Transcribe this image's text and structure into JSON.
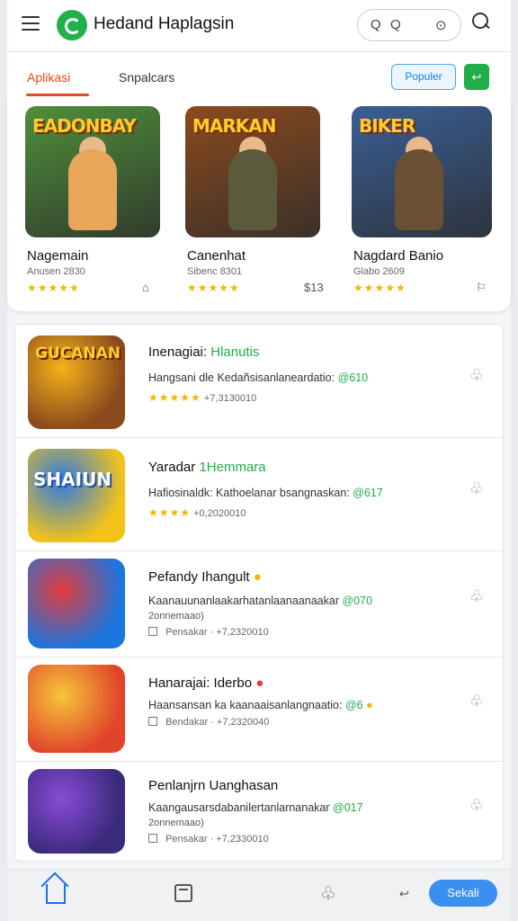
{
  "header": {
    "title": "Hedand Haplagsin",
    "pill_icons": [
      "Q",
      "Q",
      "⊙"
    ]
  },
  "tabs": {
    "items": [
      "Aplikasi",
      "Snpalcars"
    ],
    "popular_label": "Populer",
    "green_button": "↩"
  },
  "featured": [
    {
      "banner": "EADONBAY",
      "name": "Nagemain",
      "meta": "Anusen 2830",
      "rating": "★★★★★",
      "right": "⌂",
      "bg": "#4f8f3a",
      "hero": "#e8a65a"
    },
    {
      "banner": "MARKAN",
      "name": "Canenhat",
      "meta": "Sibenc 8301",
      "rating": "★★★★★",
      "right": "$13",
      "bg": "#8b4a1e",
      "hero": "#5c5a3c"
    },
    {
      "banner": "BIKER",
      "name": "Nagdard Banio",
      "meta": "Glabo 2609",
      "rating": "★★★★★",
      "right": "⚐",
      "bg": "#3a5f95",
      "hero": "#6b5036"
    }
  ],
  "list": [
    {
      "title": "Inenagiai:",
      "tag": "Hlanutis",
      "desc": "Hangsani dle Kedañsisanlaneardatio:",
      "price": "@610",
      "sub": "",
      "meta_stars": "★★★★★",
      "meta": "+7,3130010",
      "bg": "#8a4a1c",
      "accent": "#f5b21b",
      "label": "GUCANAN"
    },
    {
      "title": "Yaradar",
      "tag": "1Hemmara",
      "desc": "Hafiosinaldk: Kathoelanar bsangnaskan:",
      "price": "@617",
      "sub": "",
      "meta_stars": "★★★★",
      "meta": "+0,2020010",
      "bg": "#f2c21a",
      "accent": "#2c7be5",
      "label": "SHAIUN"
    },
    {
      "title": "Pefandy Ihangult",
      "tag": "",
      "desc": "Kaanauunanlaakarhatanlaanaanaakar",
      "price": "@070",
      "sub": "2onnemaao)",
      "meta_stars": "",
      "meta": "Pensakar · +7,2320010",
      "bg": "#1b76e0",
      "accent": "#e23b3b",
      "label": ""
    },
    {
      "title": "Hanarajai: Iderbo",
      "tag": "",
      "desc": "Haansansan ka kaanaaisanlangnaatio:",
      "price": "@6",
      "sub": "",
      "meta_stars": "",
      "meta": "Bendakar · +7,2320040",
      "bg": "#e0452a",
      "accent": "#f7c53a",
      "label": ""
    },
    {
      "title": "Penlanjrn Uanghasan",
      "tag": "",
      "desc": "Kaangausarsdabanilertanlarnanakar",
      "price": "@017",
      "sub": "2onnemaao)",
      "meta_stars": "",
      "meta": "Pensakar · +7,2330010",
      "bg": "#3a2a7a",
      "accent": "#8a4bd8",
      "label": ""
    }
  ],
  "bottom_nav": {
    "small_icon": "↩",
    "cta_label": "Sekali"
  },
  "colors": {
    "accent": "#e64a19",
    "green": "#1fae4a",
    "blue": "#3b8ff0",
    "star": "#f4b400"
  }
}
